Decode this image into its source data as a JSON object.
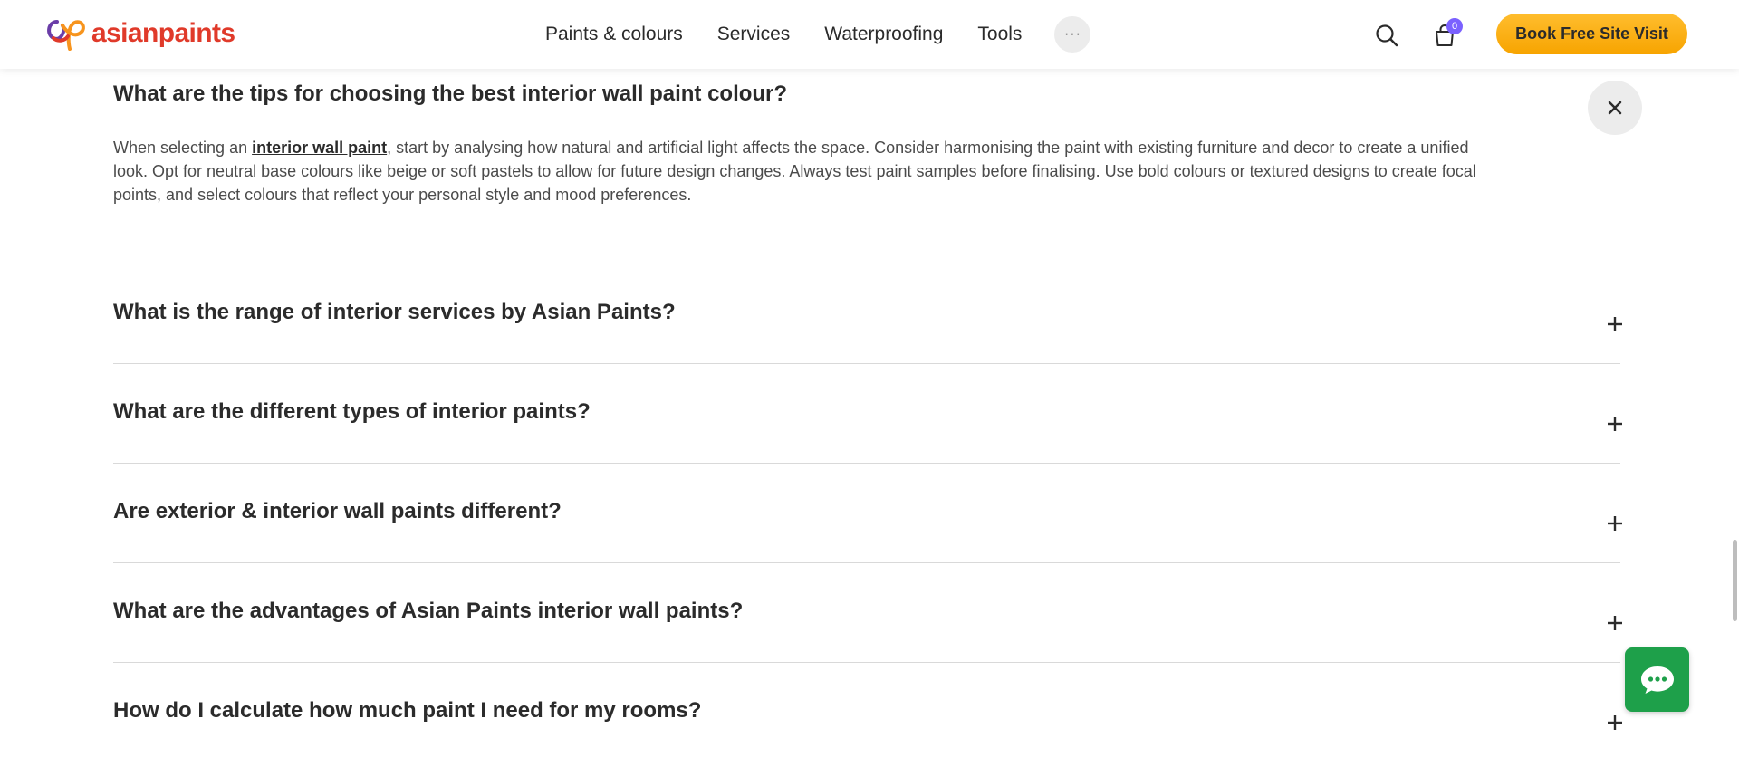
{
  "header": {
    "brand": "asianpaints",
    "nav": [
      "Paints & colours",
      "Services",
      "Waterproofing",
      "Tools"
    ],
    "more_label": "···",
    "cart_count": "0",
    "cta_label": "Book Free Site Visit"
  },
  "faq": {
    "open": {
      "question": "What are the tips for choosing the best interior wall paint colour?",
      "answer_before": "When selecting an ",
      "answer_link": "interior wall paint",
      "answer_after": ", start by analysing how natural and artificial light affects the space. Consider harmonising the paint with existing furniture and decor to create a unified look. Opt for neutral base colours like beige or soft pastels to allow for future design changes. Always test paint samples before finalising. Use bold colours or textured designs to create focal points, and select colours that reflect your personal style and mood preferences."
    },
    "items": [
      {
        "question": "What is the range of interior services by Asian Paints?"
      },
      {
        "question": "What are the different types of interior paints?"
      },
      {
        "question": "Are exterior & interior wall paints different?"
      },
      {
        "question": "What are the advantages of Asian Paints interior wall paints?"
      },
      {
        "question": "How do I calculate how much paint I need for my rooms?"
      }
    ]
  },
  "colors": {
    "brand_red": "#e03a2a",
    "cta_orange": "#f7a400",
    "badge_purple": "#7b61ff",
    "chat_green": "#1ea04a"
  },
  "icons": {
    "search": "search-icon",
    "cart": "cart-icon",
    "close": "close-icon",
    "expand": "plus-icon",
    "chat": "chat-icon"
  }
}
